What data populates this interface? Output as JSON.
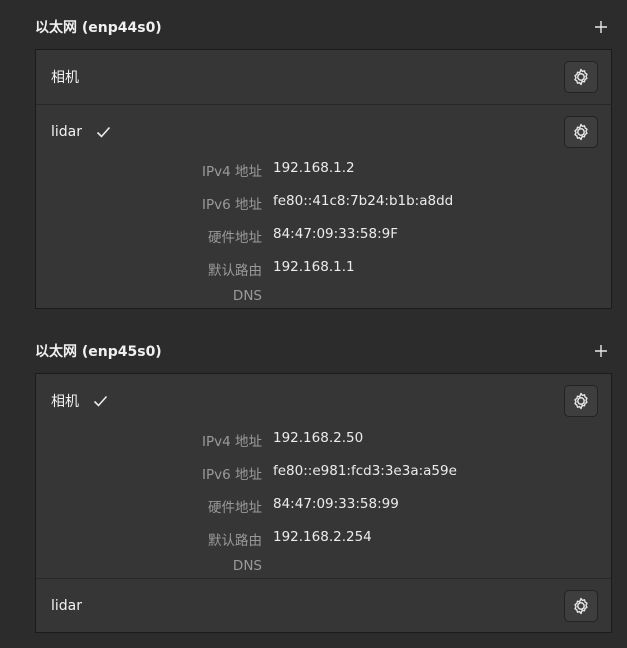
{
  "sections": [
    {
      "title": "以太网 (enp44s0)",
      "profiles": [
        {
          "name": "相机",
          "active": false
        },
        {
          "name": "lidar",
          "active": true
        }
      ],
      "details": [
        {
          "label": "IPv4 地址",
          "value": "192.168.1.2"
        },
        {
          "label": "IPv6 地址",
          "value": "fe80::41c8:7b24:b1b:a8dd"
        },
        {
          "label": "硬件地址",
          "value": "84:47:09:33:58:9F"
        },
        {
          "label": "默认路由",
          "value": "192.168.1.1"
        },
        {
          "label": "DNS",
          "value": ""
        }
      ]
    },
    {
      "title": "以太网 (enp45s0)",
      "profiles": [
        {
          "name": "相机",
          "active": true
        },
        {
          "name": "lidar",
          "active": false
        }
      ],
      "details": [
        {
          "label": "IPv4 地址",
          "value": "192.168.2.50"
        },
        {
          "label": "IPv6 地址",
          "value": "fe80::e981:fcd3:3e3a:a59e"
        },
        {
          "label": "硬件地址",
          "value": "84:47:09:33:58:99"
        },
        {
          "label": "默认路由",
          "value": "192.168.2.254"
        },
        {
          "label": "DNS",
          "value": ""
        }
      ]
    }
  ],
  "icons": {
    "add": "plus-icon",
    "settings": "gear-icon",
    "active": "checkmark-icon"
  },
  "colors": {
    "background": "#2c2c2c",
    "panel": "#363636",
    "label": "#9a9a9a",
    "text": "#f2f2f2"
  }
}
